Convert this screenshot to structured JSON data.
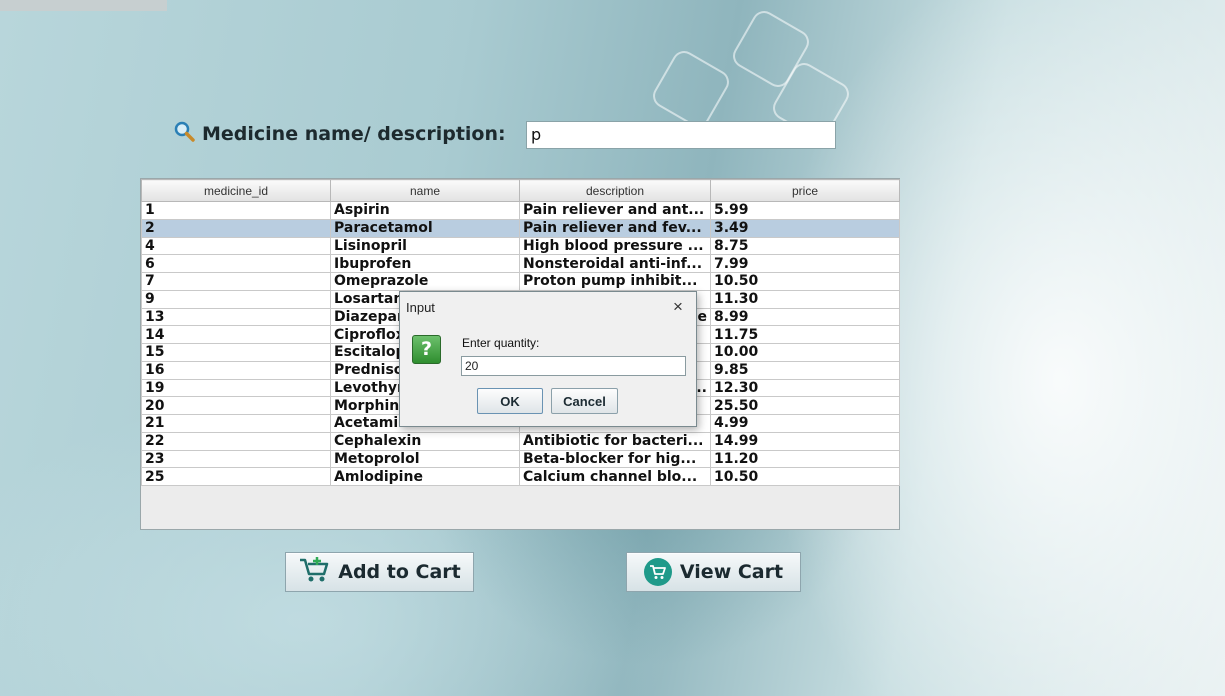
{
  "search": {
    "label": "Medicine name/ description:",
    "value": "p"
  },
  "table": {
    "columns": [
      "medicine_id",
      "name",
      "description",
      "price"
    ],
    "selected_row": 1,
    "rows": [
      [
        "1",
        "Aspirin",
        "Pain reliever and ant...",
        "5.99"
      ],
      [
        "2",
        "Paracetamol",
        "Pain reliever and fev...",
        "3.49"
      ],
      [
        "4",
        "Lisinopril",
        "High blood pressure ...",
        "8.75"
      ],
      [
        "6",
        "Ibuprofen",
        "Nonsteroidal anti-inf...",
        "7.99"
      ],
      [
        "7",
        "Omeprazole",
        "Proton pump inhibit...",
        "10.50"
      ],
      [
        "9",
        "Losartan",
        "",
        "11.30"
      ],
      [
        "13",
        "Diazepam",
        "e",
        "8.99"
      ],
      [
        "14",
        "Ciproflox",
        "",
        "11.75"
      ],
      [
        "15",
        "Escitalop",
        "",
        "10.00"
      ],
      [
        "16",
        "Predniso",
        "",
        "9.85"
      ],
      [
        "19",
        "Levothyr",
        "..",
        "12.30"
      ],
      [
        "20",
        "Morphin",
        "",
        "25.50"
      ],
      [
        "21",
        "Acetami",
        "",
        "4.99"
      ],
      [
        "22",
        "Cephalexin",
        "Antibiotic for bacteri...",
        "14.99"
      ],
      [
        "23",
        "Metoprolol",
        "Beta-blocker for hig...",
        "11.20"
      ],
      [
        "25",
        "Amlodipine",
        "Calcium channel blo...",
        "10.50"
      ]
    ]
  },
  "buttons": {
    "add_to_cart": "Add to Cart",
    "view_cart": "View Cart"
  },
  "dialog": {
    "title": "Input",
    "close": "×",
    "prompt": "Enter quantity:",
    "value": "20",
    "ok": "OK",
    "cancel": "Cancel",
    "icon": "?"
  },
  "colors": {
    "selected_row": "#b9cde0",
    "view_cart_icon": "#1f9a8a",
    "question_icon": "#3a9a3a"
  }
}
